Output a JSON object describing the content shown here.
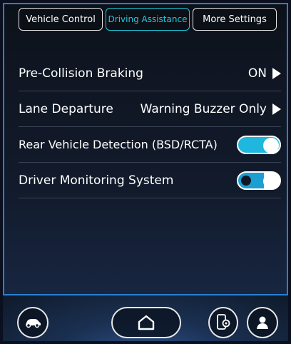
{
  "tabs": [
    {
      "label": "Vehicle Control",
      "active": false
    },
    {
      "label": "Driving Assistance",
      "active": true
    },
    {
      "label": "More Settings",
      "active": false
    }
  ],
  "settings": [
    {
      "label": "Pre-Collision Braking",
      "value": "ON",
      "control": "arrow"
    },
    {
      "label": "Lane Departure",
      "value": "Warning Buzzer Only",
      "control": "arrow"
    },
    {
      "label": "Rear Vehicle Detection (BSD/RCTA)",
      "control": "toggle",
      "state": "on"
    },
    {
      "label": "Driver Monitoring System",
      "control": "toggle",
      "state": "on"
    }
  ],
  "dock": {
    "icons": [
      "car-icon",
      "home-icon",
      "phone-settings-icon",
      "user-icon"
    ]
  },
  "colors": {
    "accent": "#1ec6d8",
    "toggle_on": "#1fb7dd",
    "frame": "#2a7fd0"
  }
}
